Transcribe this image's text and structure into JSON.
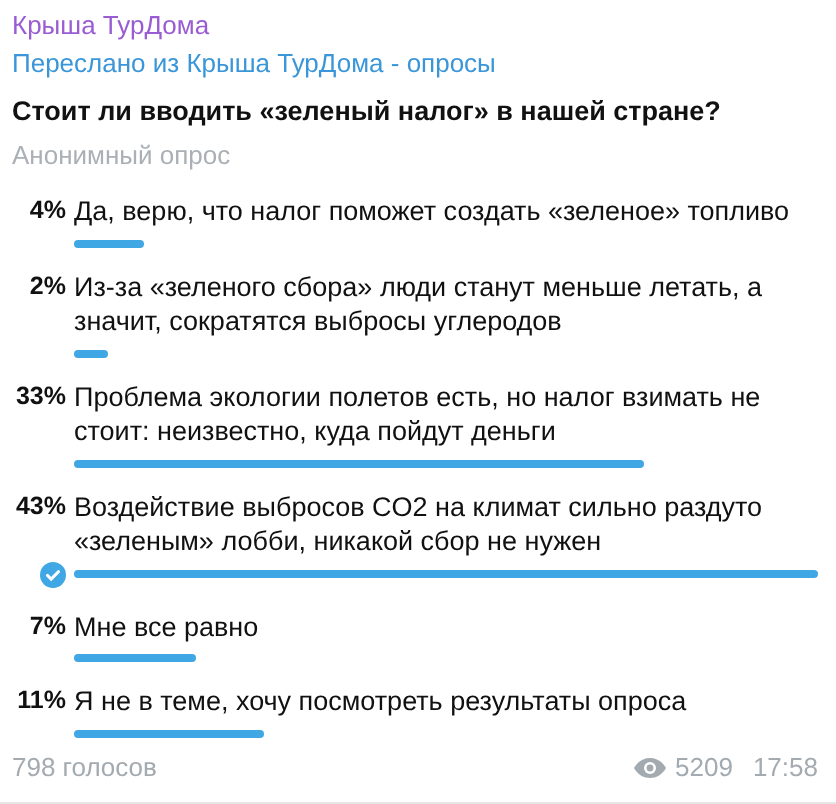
{
  "channel": {
    "name": "Крыша ТурДома",
    "forwarded_from": "Переслано из Крыша ТурДома - опросы"
  },
  "poll": {
    "question": "Стоит ли вводить «зеленый налог» в нашей стране?",
    "type_label": "Анонимный опрос",
    "options": [
      {
        "percent": "4%",
        "text": "Да, верю, что налог поможет создать «зеленое» топливо",
        "selected": false
      },
      {
        "percent": "2%",
        "text": "Из-за «зеленого сбора» люди станут меньше летать, а значит, сократятся выбросы углеродов",
        "selected": false
      },
      {
        "percent": "33%",
        "text": "Проблема экологии полетов есть, но налог взимать не стоит: неизвестно, куда пойдут деньги",
        "selected": false
      },
      {
        "percent": "43%",
        "text": "Воздействие выбросов CO2 на климат сильно раздуто «зеленым» лобби, никакой сбор не нужен",
        "selected": true
      },
      {
        "percent": "7%",
        "text": "Мне все равно",
        "selected": false
      },
      {
        "percent": "11%",
        "text": "Я не в теме, хочу посмотреть результаты опроса",
        "selected": false
      }
    ],
    "votes": "798 голосов"
  },
  "footer": {
    "views": "5209",
    "time": "17:58"
  }
}
